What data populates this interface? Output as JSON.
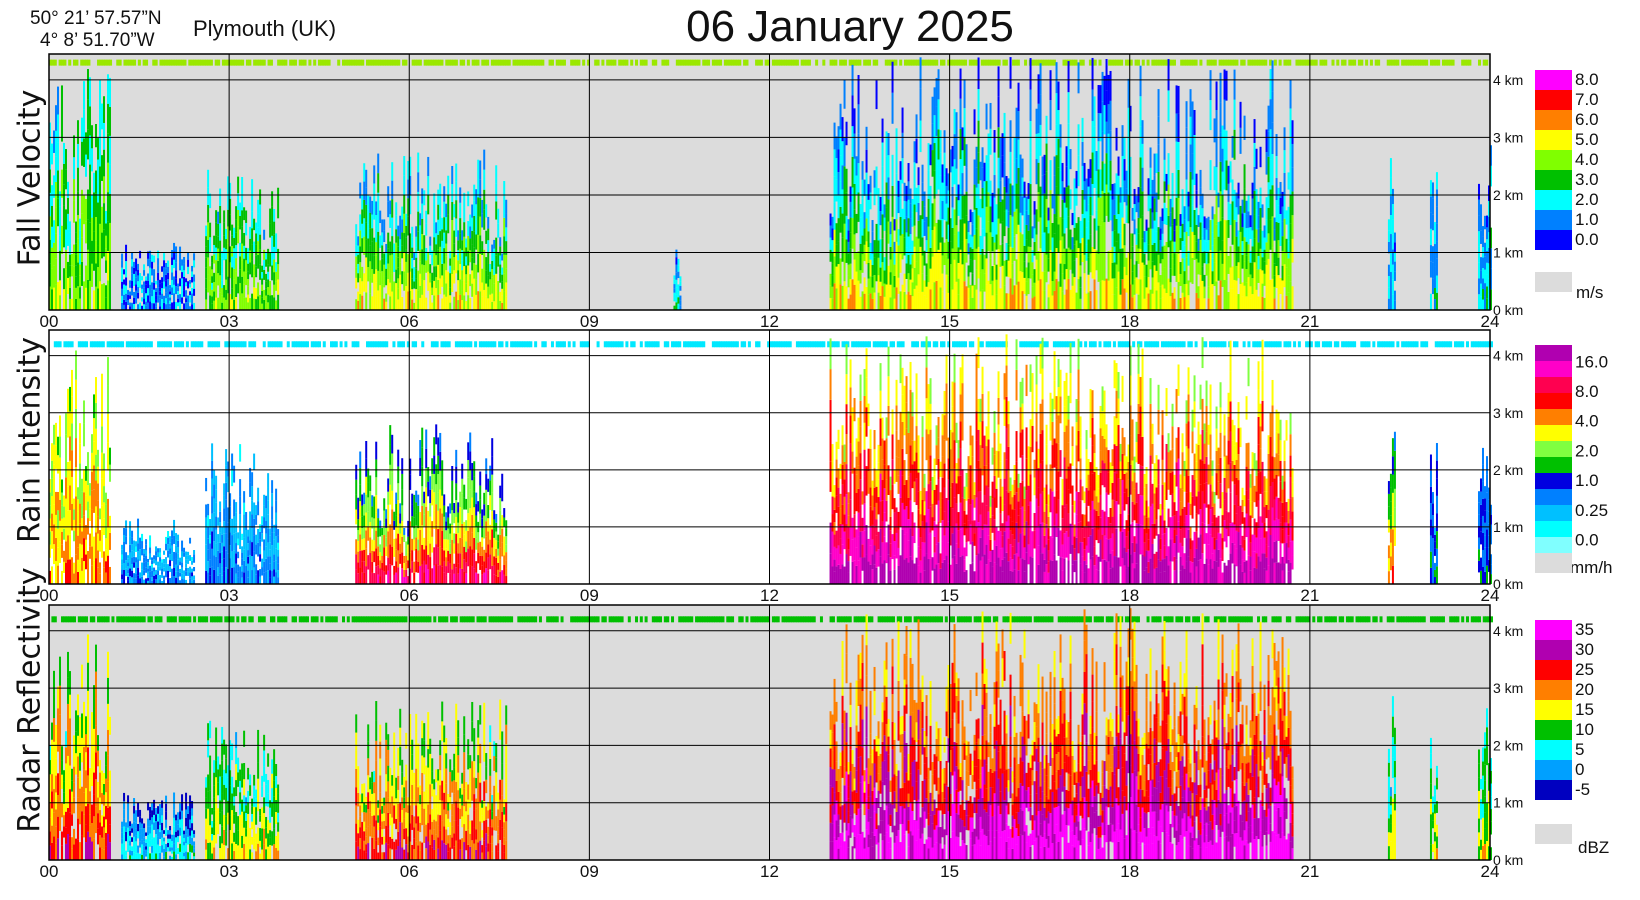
{
  "header": {
    "title": "06 January  2025",
    "lat": "50° 21’ 57.57”N",
    "lon": "4°  8’ 51.70”W",
    "location": "Plymouth (UK)"
  },
  "chart_data": [
    {
      "type": "heatmap",
      "title": "Fall Velocity",
      "xlabel": "",
      "ylabel": "Fall Velocity",
      "x_ticks": [
        "00",
        "03",
        "06",
        "09",
        "12",
        "15",
        "18",
        "21",
        "24"
      ],
      "y_ticks": [
        "0 km",
        "1 km",
        "2 km",
        "3 km",
        "4 km"
      ],
      "xlim": [
        0,
        24
      ],
      "ylim": [
        0,
        4.45
      ],
      "colorbar": {
        "unit": "m/s",
        "labels": [
          "8.0",
          "7.0",
          "6.0",
          "5.0",
          "4.0",
          "3.0",
          "2.0",
          "1.0",
          "0.0"
        ],
        "colors": [
          "#ff00ff",
          "#ff0000",
          "#ff7f00",
          "#ffff00",
          "#80ff00",
          "#00c000",
          "#00ffff",
          "#0080ff",
          "#0000ff"
        ],
        "nodata_color": "#dcdcdc"
      },
      "background": "#dcdcdc",
      "clutter_line": {
        "height_km": 4.3,
        "color": "#9be800"
      },
      "events": [
        {
          "start": 0.0,
          "end": 1.0,
          "top_km": 4.2,
          "level": 6,
          "base_level": 4
        },
        {
          "start": 1.2,
          "end": 2.4,
          "top_km": 1.2,
          "level": 7,
          "base_level": 7
        },
        {
          "start": 2.6,
          "end": 3.8,
          "top_km": 2.5,
          "level": 6,
          "base_level": 4
        },
        {
          "start": 5.1,
          "end": 7.6,
          "top_km": 2.8,
          "level": 7,
          "base_level": 3
        },
        {
          "start": 10.4,
          "end": 10.5,
          "top_km": 1.3,
          "level": 7,
          "base_level": 6
        },
        {
          "start": 13.0,
          "end": 20.7,
          "top_km": 4.4,
          "level": 8,
          "base_level": 3
        },
        {
          "start": 22.3,
          "end": 22.4,
          "top_km": 2.9,
          "level": 7,
          "base_level": 6
        },
        {
          "start": 23.0,
          "end": 23.1,
          "top_km": 2.6,
          "level": 7,
          "base_level": 6
        },
        {
          "start": 23.8,
          "end": 24.0,
          "top_km": 2.9,
          "level": 7,
          "base_level": 6
        }
      ]
    },
    {
      "type": "heatmap",
      "title": "Rain Intensity",
      "xlabel": "",
      "ylabel": "Rain Intensity",
      "x_ticks": [
        "00",
        "03",
        "06",
        "09",
        "12",
        "15",
        "18",
        "21",
        "24"
      ],
      "y_ticks": [
        "0 km",
        "1 km",
        "2 km",
        "3 km",
        "4 km"
      ],
      "xlim": [
        0,
        24
      ],
      "ylim": [
        0,
        4.45
      ],
      "colorbar": {
        "unit": "mm/h",
        "labels": [
          "16.0",
          "8.0",
          "4.0",
          "2.0",
          "1.0",
          "0.25",
          "0.0"
        ],
        "colors": [
          "#b000b0",
          "#ff00c8",
          "#ff0050",
          "#ff0000",
          "#ff7f00",
          "#ffff00",
          "#80ff40",
          "#00c000",
          "#0000e0",
          "#0080ff",
          "#00c0ff",
          "#00ffff",
          "#80ffff"
        ],
        "nodata_color": "#dcdcdc"
      },
      "background": "#ffffff",
      "clutter_line": {
        "height_km": 4.2,
        "color": "#00e8ff"
      },
      "events": [
        {
          "start": 0.0,
          "end": 1.0,
          "top_km": 4.2,
          "level": 6,
          "base_level": 4
        },
        {
          "start": 1.2,
          "end": 2.4,
          "top_km": 1.2,
          "level": 10,
          "base_level": 9
        },
        {
          "start": 2.6,
          "end": 3.8,
          "top_km": 2.5,
          "level": 10,
          "base_level": 9
        },
        {
          "start": 5.1,
          "end": 7.6,
          "top_km": 2.8,
          "level": 9,
          "base_level": 2
        },
        {
          "start": 13.0,
          "end": 20.7,
          "top_km": 4.4,
          "level": 6,
          "base_level": 0
        },
        {
          "start": 22.3,
          "end": 22.4,
          "top_km": 2.9,
          "level": 9,
          "base_level": 3
        },
        {
          "start": 23.0,
          "end": 23.1,
          "top_km": 2.6,
          "level": 9,
          "base_level": 8
        },
        {
          "start": 23.8,
          "end": 24.0,
          "top_km": 2.9,
          "level": 9,
          "base_level": 8
        }
      ]
    },
    {
      "type": "heatmap",
      "title": "Radar Reflectivity",
      "xlabel": "",
      "ylabel": "Radar Reflectivity",
      "x_ticks": [
        "00",
        "03",
        "06",
        "09",
        "12",
        "15",
        "18",
        "21",
        "24"
      ],
      "y_ticks": [
        "0 km",
        "1 km",
        "2 km",
        "3 km",
        "4 km"
      ],
      "xlim": [
        0,
        24
      ],
      "ylim": [
        0,
        4.45
      ],
      "colorbar": {
        "unit": "dBZ",
        "labels": [
          "35",
          "30",
          "25",
          "20",
          "15",
          "10",
          "5",
          "0",
          "-5"
        ],
        "colors": [
          "#ff00ff",
          "#b000b0",
          "#ff0000",
          "#ff7f00",
          "#ffff00",
          "#00c000",
          "#00ffff",
          "#00a0ff",
          "#0000c0"
        ],
        "nodata_color": "#dcdcdc"
      },
      "background": "#dcdcdc",
      "clutter_line": {
        "height_km": 4.2,
        "color": "#00c000"
      },
      "events": [
        {
          "start": 0.0,
          "end": 1.0,
          "top_km": 4.2,
          "level": 5,
          "base_level": 2
        },
        {
          "start": 1.2,
          "end": 2.4,
          "top_km": 1.2,
          "level": 8,
          "base_level": 6
        },
        {
          "start": 2.6,
          "end": 3.8,
          "top_km": 2.5,
          "level": 6,
          "base_level": 4
        },
        {
          "start": 5.1,
          "end": 7.6,
          "top_km": 2.8,
          "level": 5,
          "base_level": 2
        },
        {
          "start": 13.0,
          "end": 20.7,
          "top_km": 4.4,
          "level": 4,
          "base_level": 0
        },
        {
          "start": 22.3,
          "end": 22.4,
          "top_km": 2.9,
          "level": 6,
          "base_level": 4
        },
        {
          "start": 23.0,
          "end": 23.1,
          "top_km": 2.6,
          "level": 6,
          "base_level": 4
        },
        {
          "start": 23.8,
          "end": 24.0,
          "top_km": 2.9,
          "level": 6,
          "base_level": 4
        }
      ]
    }
  ]
}
